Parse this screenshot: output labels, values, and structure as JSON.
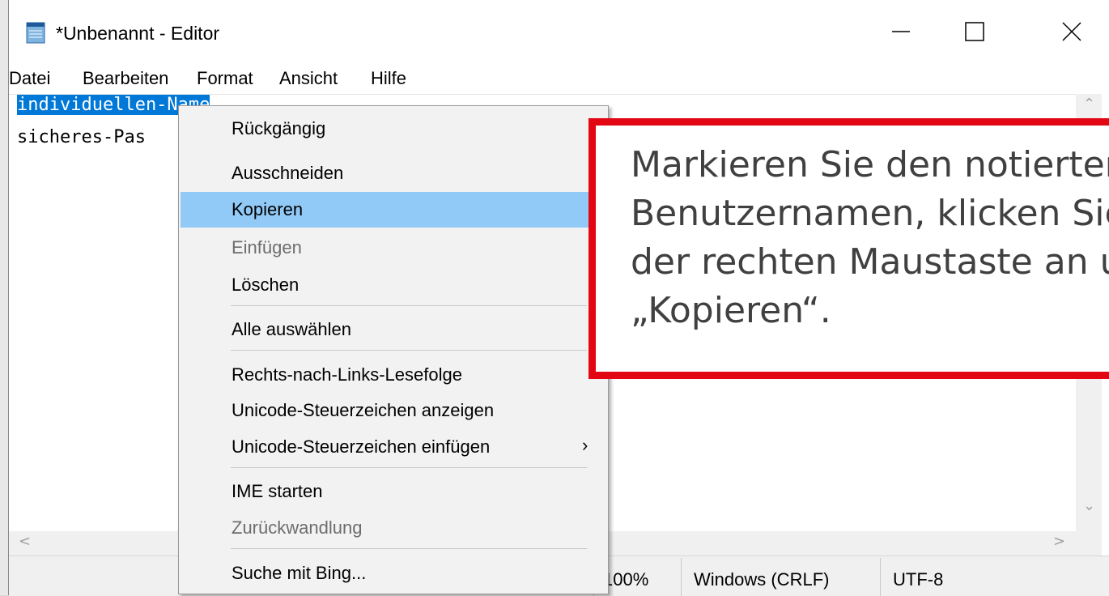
{
  "window": {
    "title": "*Unbenannt - Editor"
  },
  "menu": [
    "Datei",
    "Bearbeiten",
    "Format",
    "Ansicht",
    "Hilfe"
  ],
  "editor": {
    "line1_selected": "individuellen-Name",
    "line2": "sicheres-Pas"
  },
  "context_menu": {
    "items": [
      {
        "label": "Rückgängig",
        "enabled": true
      },
      {
        "label": "Ausschneiden",
        "enabled": true
      },
      {
        "label": "Kopieren",
        "enabled": true,
        "highlighted": true
      },
      {
        "label": "Einfügen",
        "enabled": false
      },
      {
        "label": "Löschen",
        "enabled": true
      },
      {
        "label": "Alle auswählen",
        "enabled": true
      },
      {
        "label": "Rechts-nach-Links-Lesefolge",
        "enabled": true
      },
      {
        "label": "Unicode-Steuerzeichen anzeigen",
        "enabled": true
      },
      {
        "label": "Unicode-Steuerzeichen einfügen",
        "enabled": true,
        "submenu": true
      },
      {
        "label": "IME starten",
        "enabled": true
      },
      {
        "label": "Zurückwandlung",
        "enabled": false
      },
      {
        "label": "Suche mit Bing...",
        "enabled": true
      }
    ]
  },
  "status": {
    "zoom": "100%",
    "line_ending": "Windows (CRLF)",
    "encoding": "UTF-8"
  },
  "callout": {
    "text": "Markieren Sie den notierten\nBenutzernamen, klicken Sie\nder rechten Maustaste an ur\n„Kopieren“.",
    "border_color": "#e30613"
  },
  "colors": {
    "selection": "#0078d7",
    "menu_highlight": "#91c9f7"
  },
  "icons": {
    "app": "notepad-icon",
    "minimize": "minimize-icon",
    "maximize": "maximize-icon",
    "close": "close-icon",
    "submenu": "chevron-right-icon"
  }
}
